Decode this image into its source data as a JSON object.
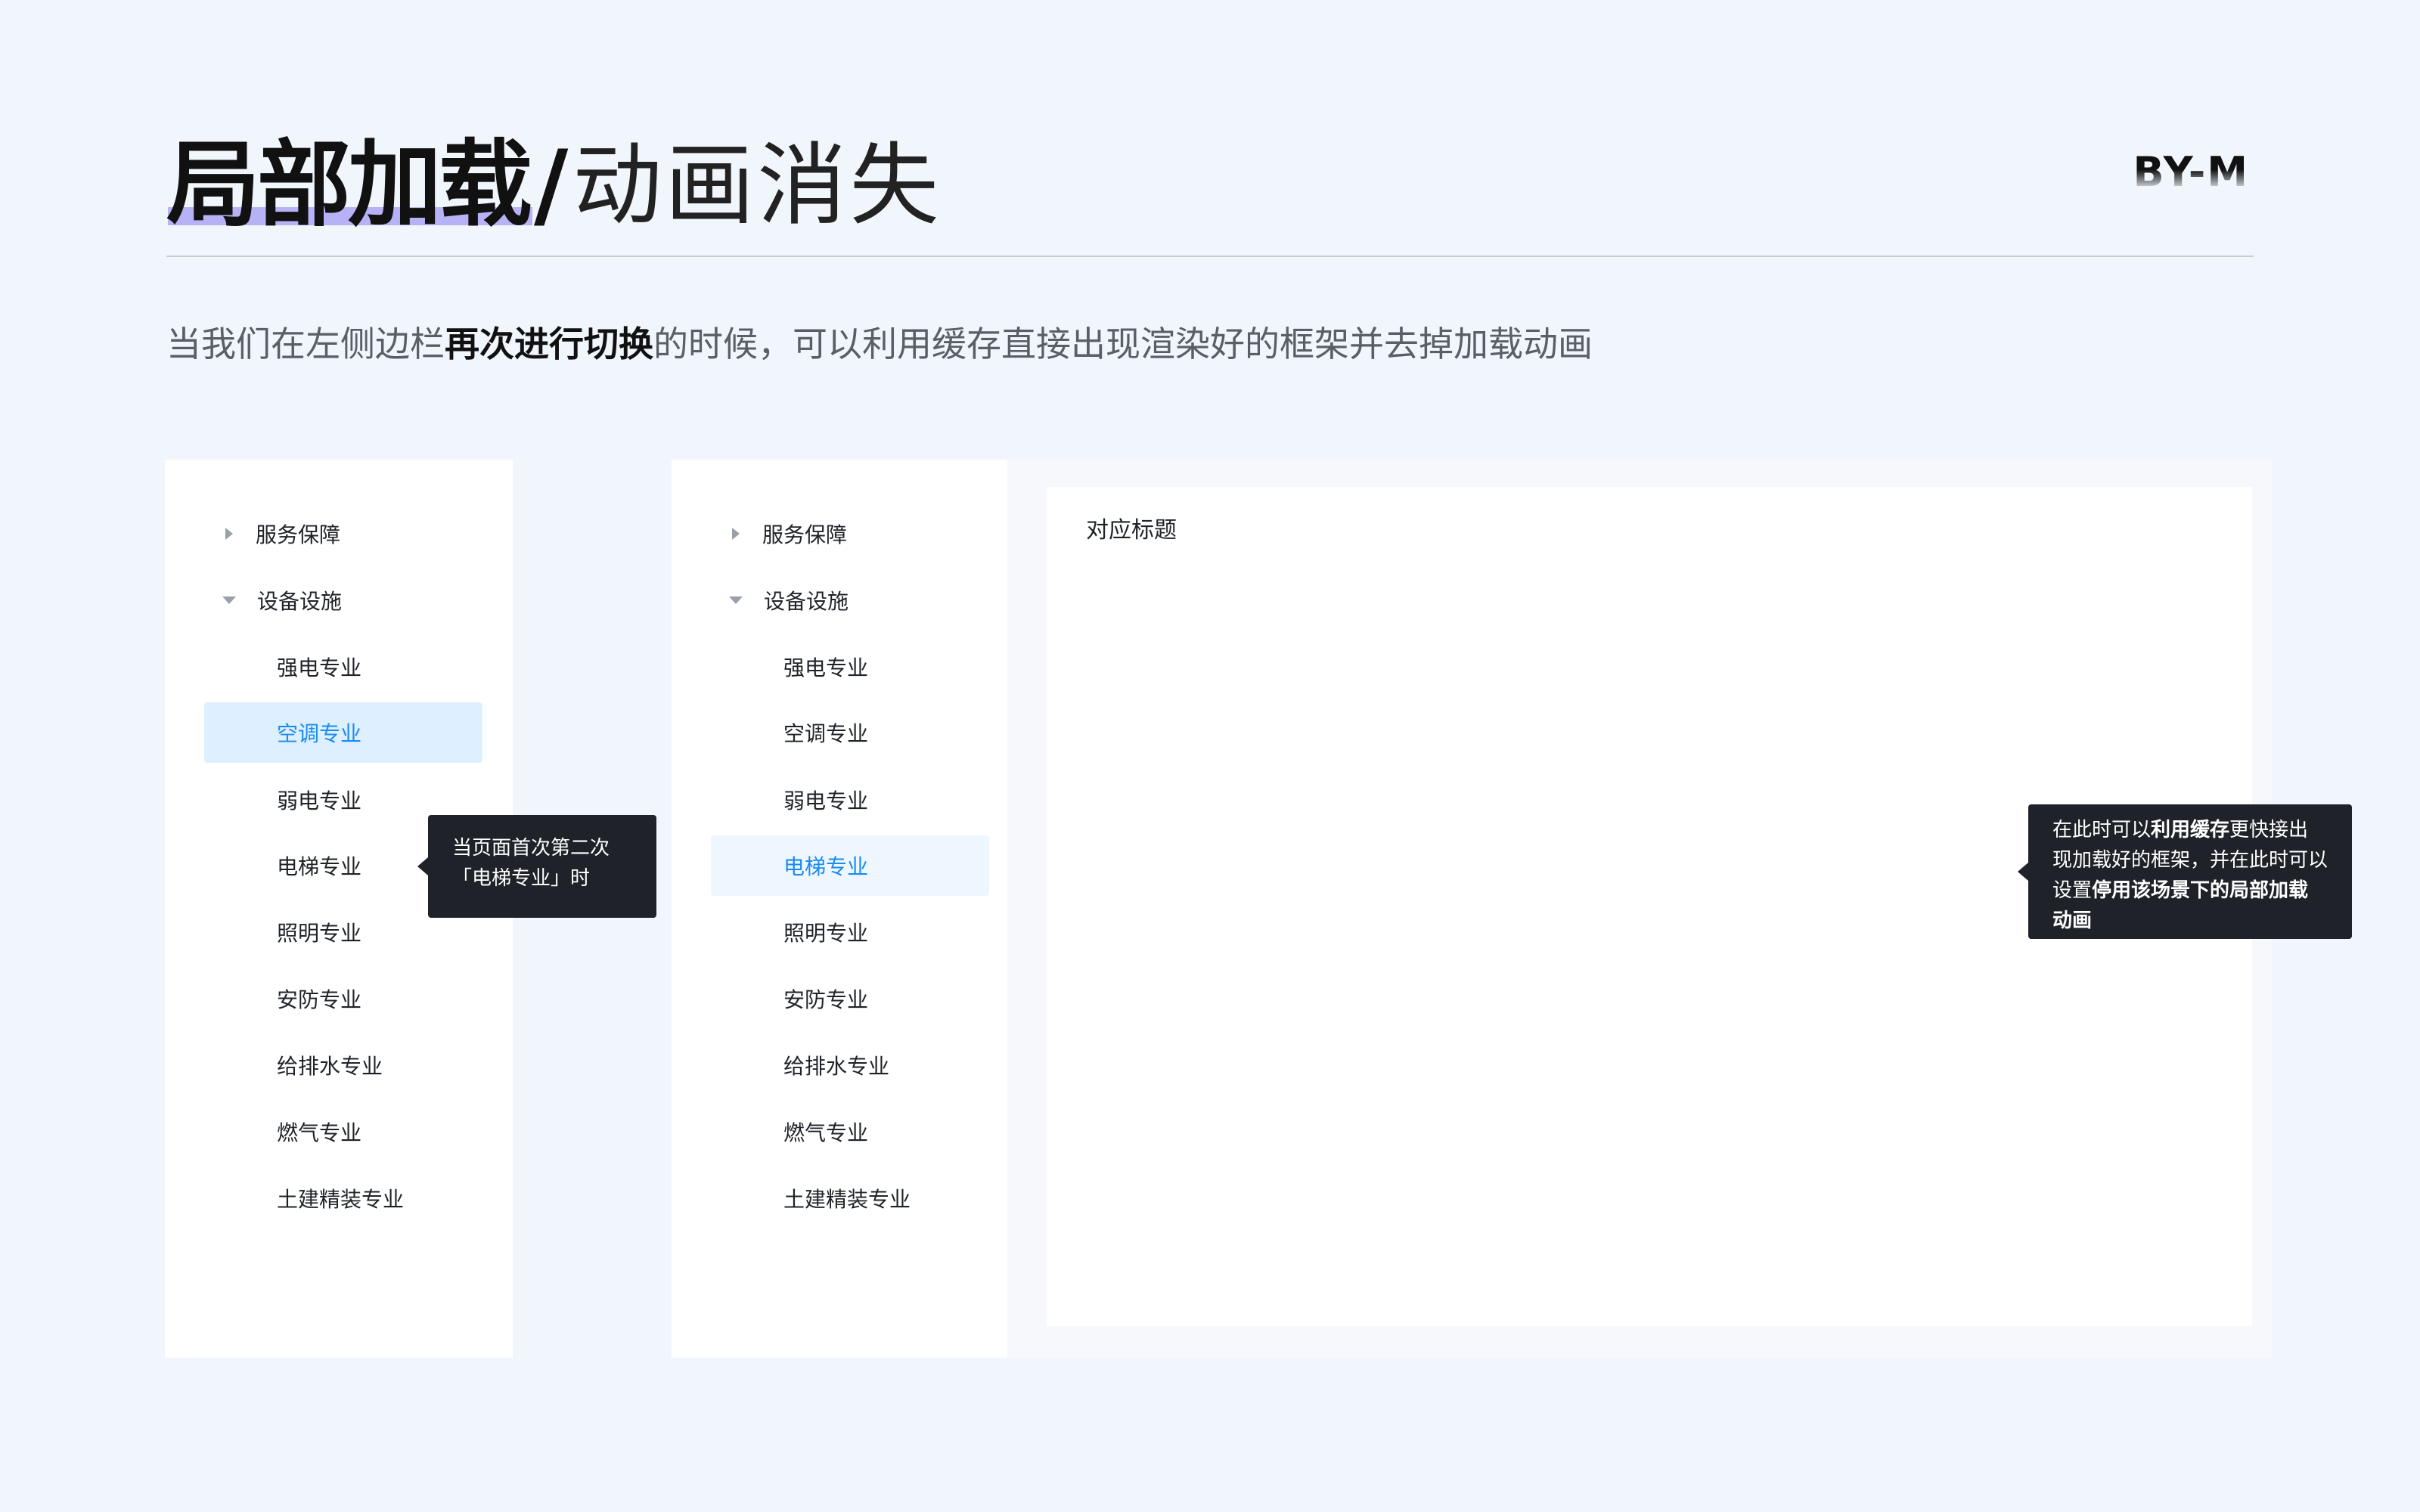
{
  "header": {
    "title_bold": "局部加载",
    "title_slash": "/",
    "title_light": "动画消失",
    "brand": "BY-M",
    "description": {
      "part1": "当我们在左侧边栏",
      "bold": "再次进行切换",
      "part2": "的时候，可以利用缓存直接出现渲染好的框架并去掉加载动画"
    }
  },
  "left_menu": {
    "groups": [
      {
        "label": "服务保障",
        "state": "collapsed"
      },
      {
        "label": "设备设施",
        "state": "expanded"
      }
    ],
    "items": [
      "强电专业",
      "空调专业",
      "弱电专业",
      "电梯专业",
      "照明专业",
      "安防专业",
      "给排水专业",
      "燃气专业",
      "土建精装专业"
    ],
    "selected": "空调专业"
  },
  "mid_menu": {
    "groups": [
      {
        "label": "服务保障",
        "state": "collapsed"
      },
      {
        "label": "设备设施",
        "state": "expanded"
      }
    ],
    "items": [
      "强电专业",
      "空调专业",
      "弱电专业",
      "电梯专业",
      "照明专业",
      "安防专业",
      "给排水专业",
      "燃气专业",
      "土建精装专业"
    ],
    "selected": "电梯专业"
  },
  "content": {
    "title": "对应标题"
  },
  "tooltips": {
    "left": {
      "line1": "当页面首次第二次",
      "line2": "「电梯专业」时"
    },
    "right": {
      "t1": "在此时可以",
      "b1": "利用缓存",
      "t2": "更快接出现加载好的框架，并在此时可以设置",
      "b2": "停用该场景下的局部加载动画"
    }
  },
  "colors": {
    "background": "#f1f6fd",
    "accent": "#1a8cf0",
    "highlight": "#b7b2f5",
    "tooltip_bg": "#1f2329"
  }
}
